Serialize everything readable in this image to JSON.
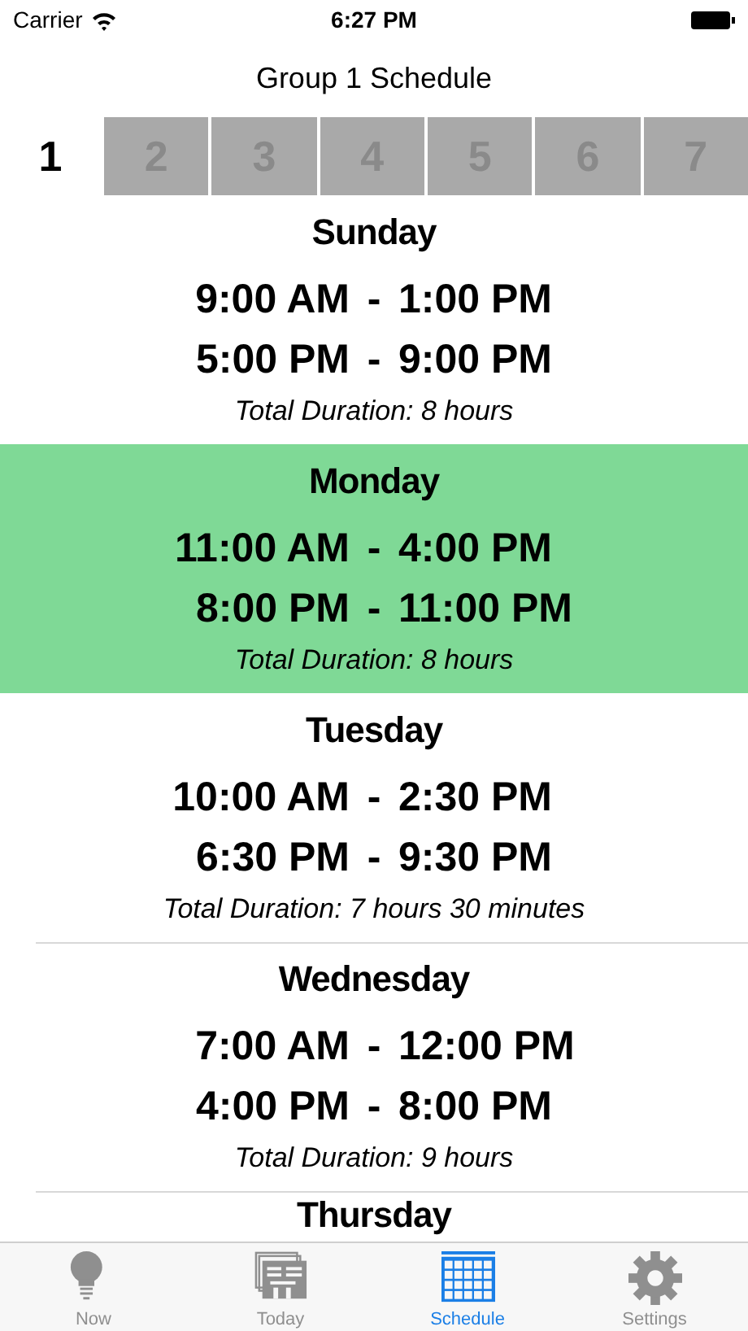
{
  "status_bar": {
    "carrier": "Carrier",
    "time": "6:27 PM"
  },
  "title": "Group 1 Schedule",
  "groups": [
    {
      "label": "1",
      "selected": true
    },
    {
      "label": "2",
      "selected": false
    },
    {
      "label": "3",
      "selected": false
    },
    {
      "label": "4",
      "selected": false
    },
    {
      "label": "5",
      "selected": false
    },
    {
      "label": "6",
      "selected": false
    },
    {
      "label": "7",
      "selected": false
    }
  ],
  "days": [
    {
      "name": "Sunday",
      "highlighted": false,
      "slots": [
        {
          "start": "9:00 AM",
          "dash": "-",
          "end": "1:00 PM"
        },
        {
          "start": "5:00 PM",
          "dash": "-",
          "end": "9:00 PM"
        }
      ],
      "total": "Total Duration: 8 hours"
    },
    {
      "name": "Monday",
      "highlighted": true,
      "slots": [
        {
          "start": "11:00 AM",
          "dash": "-",
          "end": "4:00 PM"
        },
        {
          "start": "8:00 PM",
          "dash": "-",
          "end": "11:00 PM"
        }
      ],
      "total": "Total Duration: 8 hours"
    },
    {
      "name": "Tuesday",
      "highlighted": false,
      "slots": [
        {
          "start": "10:00 AM",
          "dash": "-",
          "end": "2:30 PM"
        },
        {
          "start": "6:30 PM",
          "dash": "-",
          "end": "9:30 PM"
        }
      ],
      "total": "Total Duration: 7 hours 30 minutes"
    },
    {
      "name": "Wednesday",
      "highlighted": false,
      "slots": [
        {
          "start": "7:00 AM",
          "dash": "-",
          "end": "12:00 PM"
        },
        {
          "start": "4:00 PM",
          "dash": "-",
          "end": "8:00 PM"
        }
      ],
      "total": "Total Duration: 9 hours"
    },
    {
      "name": "Thursday",
      "highlighted": false
    }
  ],
  "tab_bar": [
    {
      "kind": "bulb",
      "label": "Now",
      "selected": false
    },
    {
      "kind": "papers",
      "label": "Today",
      "selected": false
    },
    {
      "kind": "calendar",
      "label": "Schedule",
      "selected": true
    },
    {
      "kind": "gear",
      "label": "Settings",
      "selected": false
    }
  ]
}
